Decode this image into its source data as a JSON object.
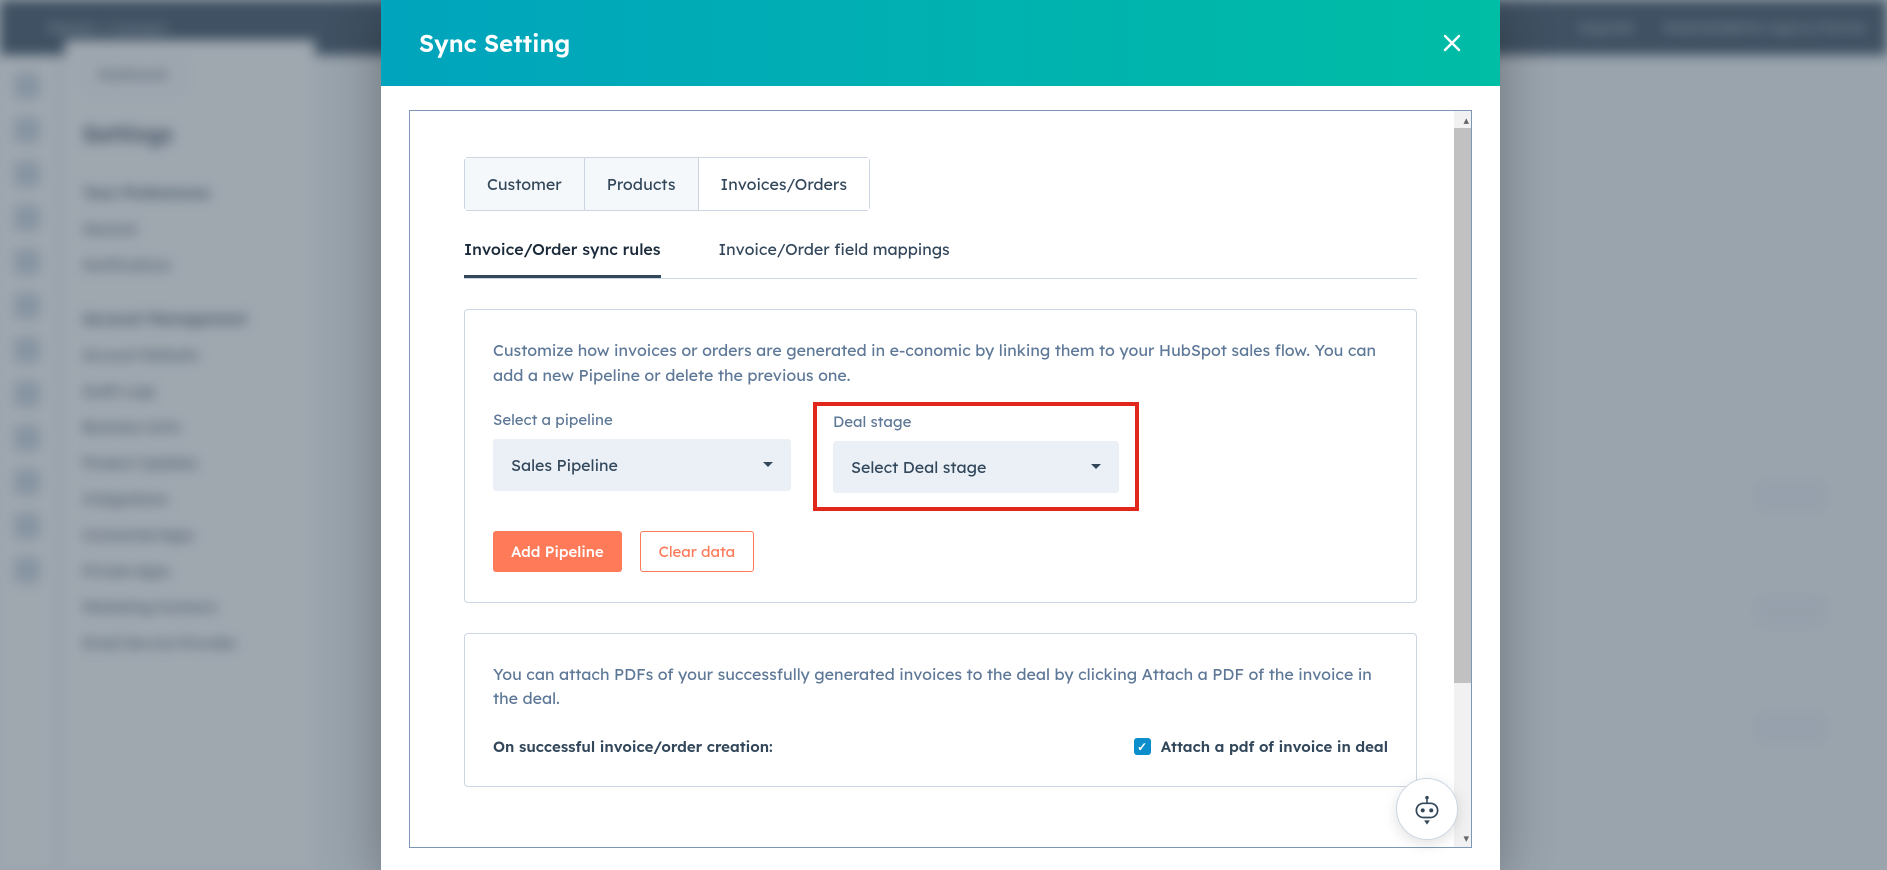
{
  "background": {
    "topMenu": "Market + Connect",
    "upgrade": "Upgrade",
    "account": "MakeWebBetter Agency Partner",
    "back": "Dashboard",
    "settingsTitle": "Settings",
    "pref": "Your Preferences",
    "prefItems": [
      "General",
      "Notifications"
    ],
    "mgmt": "Account Management",
    "mgmtItems": [
      "Account Defaults",
      "Audit Logs",
      "Business Units",
      "Product Updates",
      "Integrations",
      "Connected Apps",
      "Private Apps",
      "Marketing Contacts",
      "Email Service Provider"
    ]
  },
  "modal": {
    "title": "Sync Setting",
    "tabs": [
      "Customer",
      "Products",
      "Invoices/Orders"
    ],
    "activeTab": 2,
    "subtabs": [
      "Invoice/Order sync rules",
      "Invoice/Order field mappings"
    ],
    "activeSubtab": 0,
    "card1": {
      "desc": "Customize how invoices or orders are generated in e-conomic by linking them to your HubSpot sales flow. You can add a new Pipeline or delete the previous one.",
      "pipelineLabel": "Select a pipeline",
      "pipelineValue": "Sales Pipeline",
      "dealLabel": "Deal stage",
      "dealValue": "Select Deal stage",
      "addPipeline": "Add Pipeline",
      "clearData": "Clear data"
    },
    "card2": {
      "desc": "You can attach PDFs of your successfully generated invoices to the deal by clicking Attach a PDF of the invoice in the deal.",
      "label": "On successful invoice/order creation:",
      "checkbox": "Attach a pdf of invoice in deal",
      "checked": true
    }
  }
}
